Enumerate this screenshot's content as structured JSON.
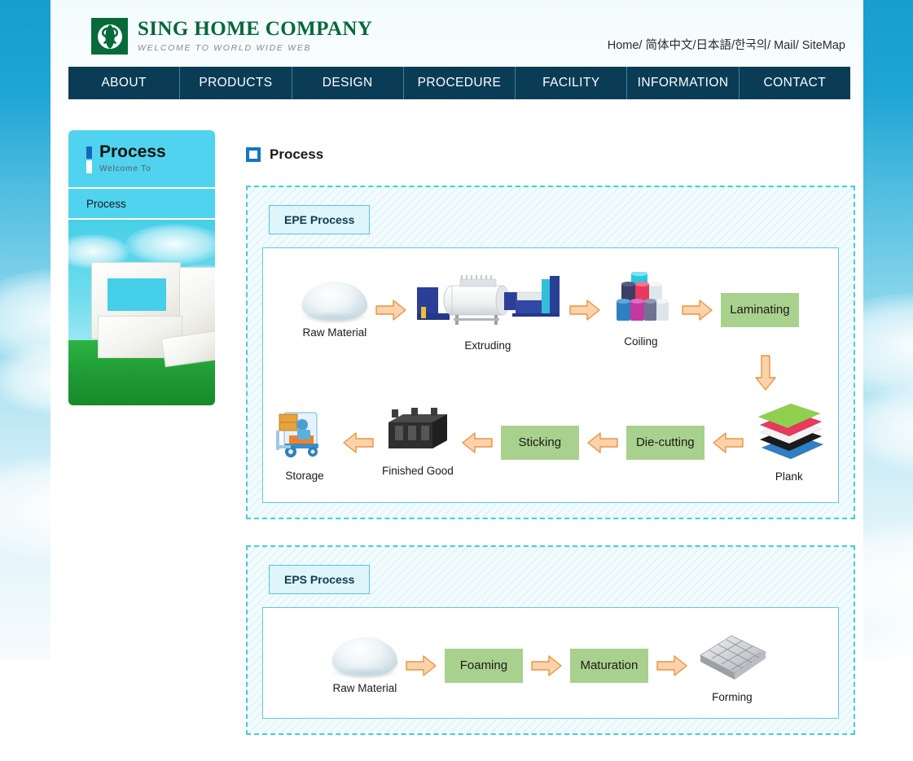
{
  "header": {
    "logo_title": "SING HOME COMPANY",
    "logo_sub": "WELCOME TO WORLD WIDE WEB",
    "top_links": [
      {
        "label": "Home",
        "sep": "/"
      },
      {
        "label": "简体中文",
        "sep": "/"
      },
      {
        "label": "日本語",
        "sep": "/"
      },
      {
        "label": "한국의",
        "sep": "/"
      },
      {
        "label": "Mail",
        "sep": "/"
      },
      {
        "label": "SiteMap",
        "sep": ""
      }
    ]
  },
  "nav": {
    "items": [
      {
        "label": "ABOUT"
      },
      {
        "label": "PRODUCTS"
      },
      {
        "label": "DESIGN"
      },
      {
        "label": "PROCEDURE"
      },
      {
        "label": "FACILITY"
      },
      {
        "label": "INFORMATION"
      },
      {
        "label": "CONTACT"
      }
    ]
  },
  "sidebar": {
    "title": "Process",
    "subtitle": "Welcome To",
    "items": [
      {
        "label": "Process"
      }
    ]
  },
  "main": {
    "page_title": "Process",
    "sections": [
      {
        "tab_label": "EPE Process",
        "row1": [
          {
            "type": "art",
            "art": "pellets",
            "caption": "Raw Material"
          },
          {
            "type": "arrow",
            "dir": "right"
          },
          {
            "type": "art",
            "art": "extruder",
            "caption": "Extruding"
          },
          {
            "type": "arrow",
            "dir": "right"
          },
          {
            "type": "art",
            "art": "coils",
            "caption": "Coiling"
          },
          {
            "type": "arrow",
            "dir": "right"
          },
          {
            "type": "box",
            "label": "Laminating"
          }
        ],
        "down_arrow": true,
        "row2": [
          {
            "type": "art",
            "art": "forklift",
            "caption": "Storage"
          },
          {
            "type": "arrow",
            "dir": "left"
          },
          {
            "type": "art",
            "art": "finished-good",
            "caption": "Finished Good"
          },
          {
            "type": "arrow",
            "dir": "left"
          },
          {
            "type": "box",
            "label": "Sticking"
          },
          {
            "type": "arrow",
            "dir": "left"
          },
          {
            "type": "box",
            "label": "Die-cutting"
          },
          {
            "type": "arrow",
            "dir": "left"
          },
          {
            "type": "art",
            "art": "plank-stack",
            "caption": "Plank"
          }
        ]
      },
      {
        "tab_label": "EPS Process",
        "row1": [
          {
            "type": "art",
            "art": "pellets",
            "caption": "Raw Material"
          },
          {
            "type": "arrow",
            "dir": "right"
          },
          {
            "type": "box",
            "label": "Foaming"
          },
          {
            "type": "arrow",
            "dir": "right"
          },
          {
            "type": "box",
            "label": "Maturation"
          },
          {
            "type": "arrow",
            "dir": "right"
          },
          {
            "type": "art",
            "art": "form-tray",
            "caption": "Forming"
          }
        ],
        "down_arrow": false,
        "row2": []
      }
    ]
  },
  "colors": {
    "nav_bg": "#0a3c56",
    "logo_green": "#066b3a",
    "sidebar_cyan": "#4fd3ee",
    "accent_blue": "#1277c8",
    "dashed_border": "#3fcfdd",
    "box_green": "#a9d18e",
    "arrow_fill": "#fbd2ab",
    "arrow_stroke": "#e8953f",
    "sky_top": "#179ed0"
  }
}
